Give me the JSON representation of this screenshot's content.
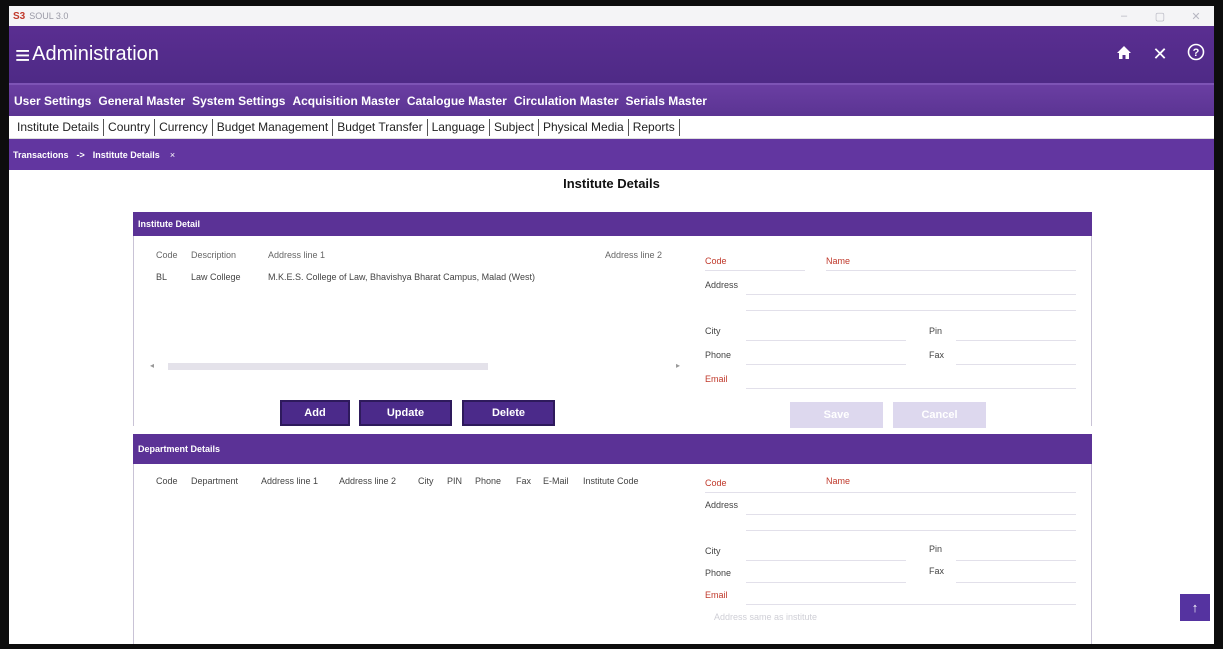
{
  "window": {
    "logo": "S3",
    "title": "SOUL 3.0",
    "minimize": "–",
    "maximize": "▢",
    "close": "✕"
  },
  "header": {
    "menu_icon": "≡",
    "title": "Administration",
    "home_icon": "🏠",
    "close_icon": "✕",
    "help_icon": "?"
  },
  "topmenu": [
    "User Settings",
    "General Master",
    "System Settings",
    "Acquisition Master",
    "Catalogue Master",
    "Circulation Master",
    "Serials Master"
  ],
  "submenu": [
    "Institute Details",
    "Country",
    "Currency",
    "Budget Management",
    "Budget Transfer",
    "Language",
    "Subject",
    "Physical Media",
    "Reports"
  ],
  "breadcrumb": {
    "root": "Transactions",
    "arrow": "->",
    "current": "Institute Details",
    "close": "×"
  },
  "page_title": "Institute Details",
  "institute_panel": {
    "title": "Institute Detail",
    "columns": {
      "code": "Code",
      "description": "Description",
      "address1": "Address line 1",
      "address2": "Address line 2"
    },
    "row": {
      "code": "BL",
      "description": "Law College",
      "address1": "M.K.E.S. College of Law, Bhavishya Bharat Campus, Malad (West)"
    },
    "form": {
      "code": "Code",
      "name": "Name",
      "address": "Address",
      "city": "City",
      "pin": "Pin",
      "phone": "Phone",
      "fax": "Fax",
      "email": "Email"
    },
    "buttons": {
      "add": "Add",
      "update": "Update",
      "delete": "Delete",
      "save": "Save",
      "cancel": "Cancel"
    }
  },
  "department_panel": {
    "title": "Department Details",
    "columns": [
      "Code",
      "Department",
      "Address line 1",
      "Address line 2",
      "City",
      "PIN",
      "Phone",
      "Fax",
      "E-Mail",
      "Institute Code"
    ],
    "form": {
      "code": "Code",
      "name": "Name",
      "address": "Address",
      "city": "City",
      "pin": "Pin",
      "phone": "Phone",
      "fax": "Fax",
      "email": "Email",
      "same_as_institute": "Address same as institute"
    }
  },
  "scroll_top_icon": "↑"
}
